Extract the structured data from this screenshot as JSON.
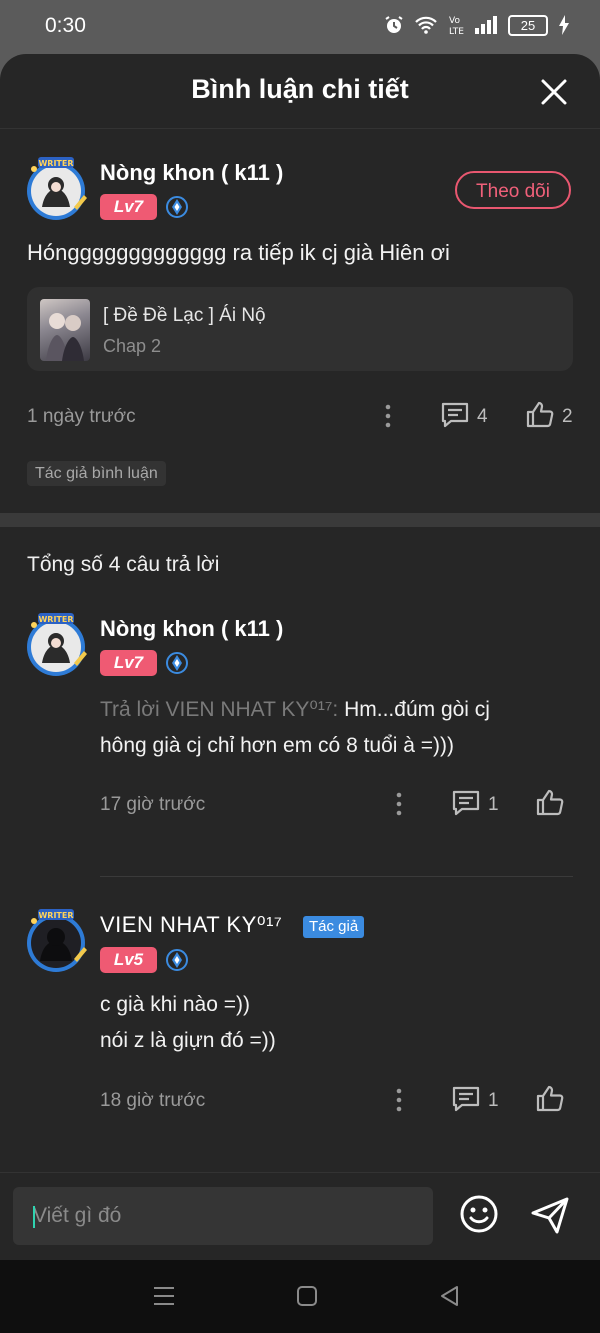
{
  "status_bar": {
    "time": "0:30",
    "battery": "25"
  },
  "header": {
    "title": "Bình luận chi tiết"
  },
  "main_comment": {
    "username": "Nòng khon ( k11 )",
    "level": "Lv7",
    "follow_label": "Theo dõi",
    "text": "Hónggggggggggggg ra tiếp ik cj già Hiên ơi",
    "story": {
      "title": "[ Đề Đề Lạc ] Ái Nộ",
      "chapter": "Chap 2"
    },
    "time": "1 ngày trước",
    "reply_count": "4",
    "like_count": "2",
    "tag": "Tác giả bình luận"
  },
  "replies_header": "Tổng số 4 câu trả lời",
  "replies": [
    {
      "username": "Nòng khon ( k11 )",
      "level": "Lv7",
      "reply_to": "Trả lời VIEN NHAT KY⁰¹⁷:",
      "text_line1": " Hm...đúm gòi cj",
      "text_line2": "hông già cj chỉ hơn em có 8 tuổi à =)))",
      "time": "17 giờ trước",
      "reply_count": "1"
    },
    {
      "username": "VIEN NHAT KY⁰¹⁷",
      "author_badge": "Tác giả",
      "level": "Lv5",
      "text_line1": "c già khi nào =))",
      "text_line2": "nói z là giựn đó =))",
      "time": "18 giờ trước",
      "reply_count": "1"
    }
  ],
  "input": {
    "placeholder": "Viết gì đó"
  },
  "colors": {
    "accent_pink": "#ef5a73",
    "author_blue": "#3b8be0",
    "background": "#262626"
  }
}
